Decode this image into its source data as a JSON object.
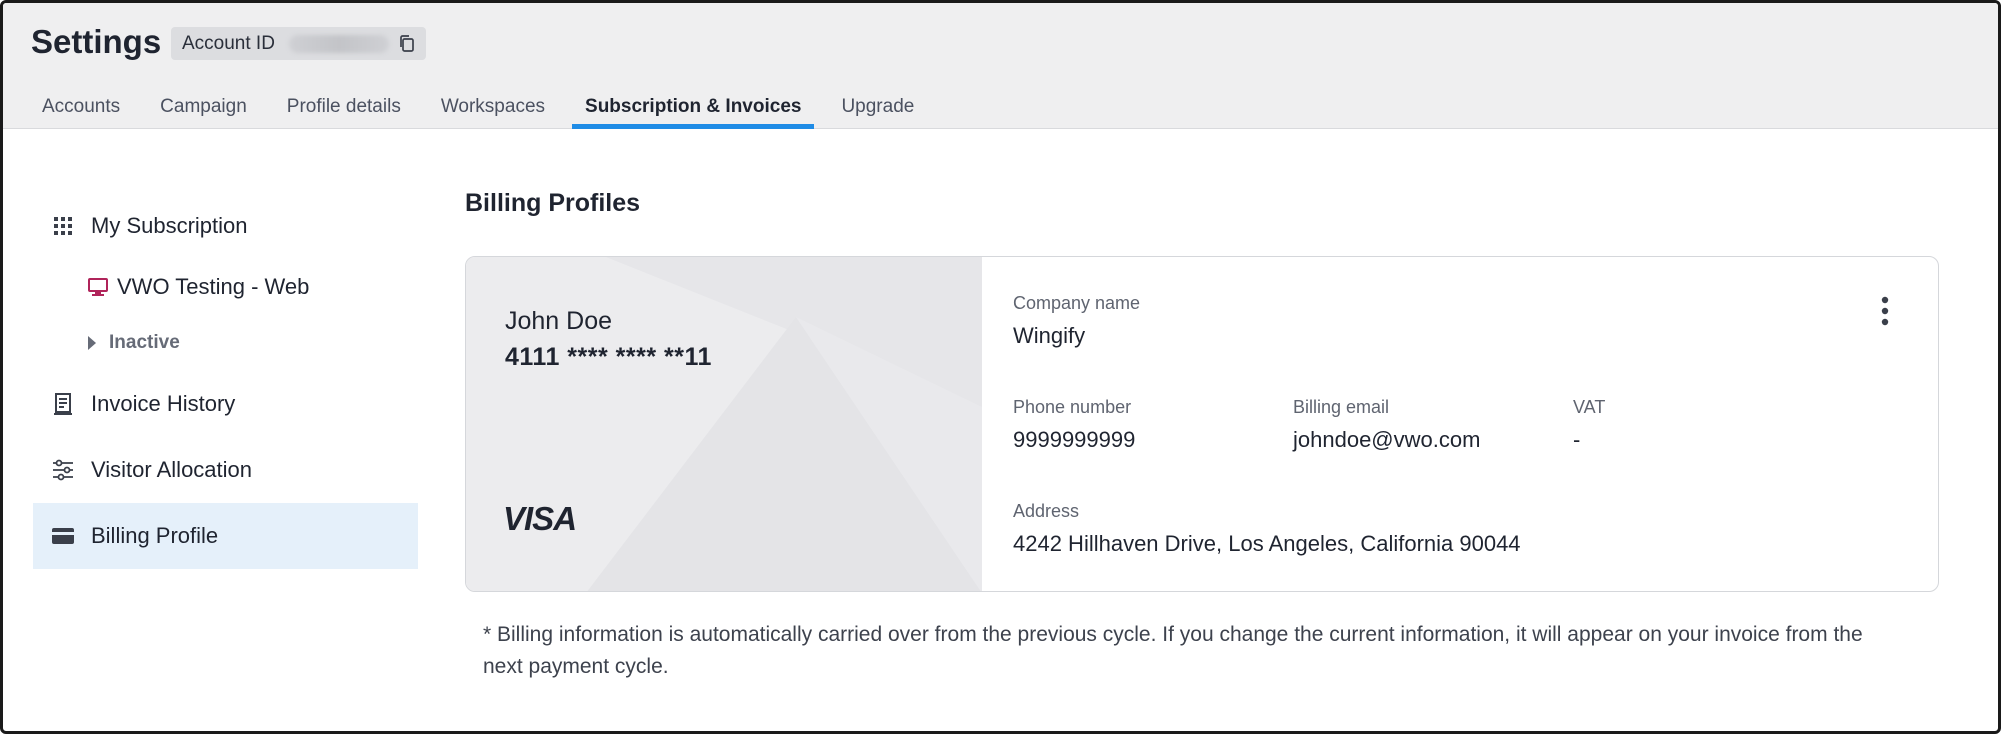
{
  "header": {
    "title": "Settings",
    "account_id_label": "Account ID"
  },
  "tabs": [
    {
      "label": "Accounts"
    },
    {
      "label": "Campaign"
    },
    {
      "label": "Profile details"
    },
    {
      "label": "Workspaces"
    },
    {
      "label": "Subscription & Invoices"
    },
    {
      "label": "Upgrade"
    }
  ],
  "active_tab": "Subscription & Invoices",
  "sidebar": {
    "my_subscription": "My Subscription",
    "product": "VWO Testing - Web",
    "inactive": "Inactive",
    "invoice_history": "Invoice History",
    "visitor_allocation": "Visitor Allocation",
    "billing_profile": "Billing Profile"
  },
  "main": {
    "section_title": "Billing Profiles",
    "card": {
      "holder_name": "John Doe",
      "card_number": "4111 **** **** **11",
      "brand": "VISA",
      "company_label": "Company name",
      "company_value": "Wingify",
      "phone_label": "Phone number",
      "phone_value": "9999999999",
      "email_label": "Billing email",
      "email_value": "johndoe@vwo.com",
      "vat_label": "VAT",
      "vat_value": "-",
      "address_label": "Address",
      "address_value": "4242 Hillhaven Drive, Los Angeles, California 90044"
    },
    "note": "* Billing information is automatically carried over from the previous cycle. If you change the current information, it will appear on your invoice from the next payment cycle."
  },
  "colors": {
    "accent": "#1f8ce6",
    "active_sidebar_bg": "#e5f0fa",
    "header_bg": "#efeff0",
    "product_icon": "#b0245a"
  }
}
